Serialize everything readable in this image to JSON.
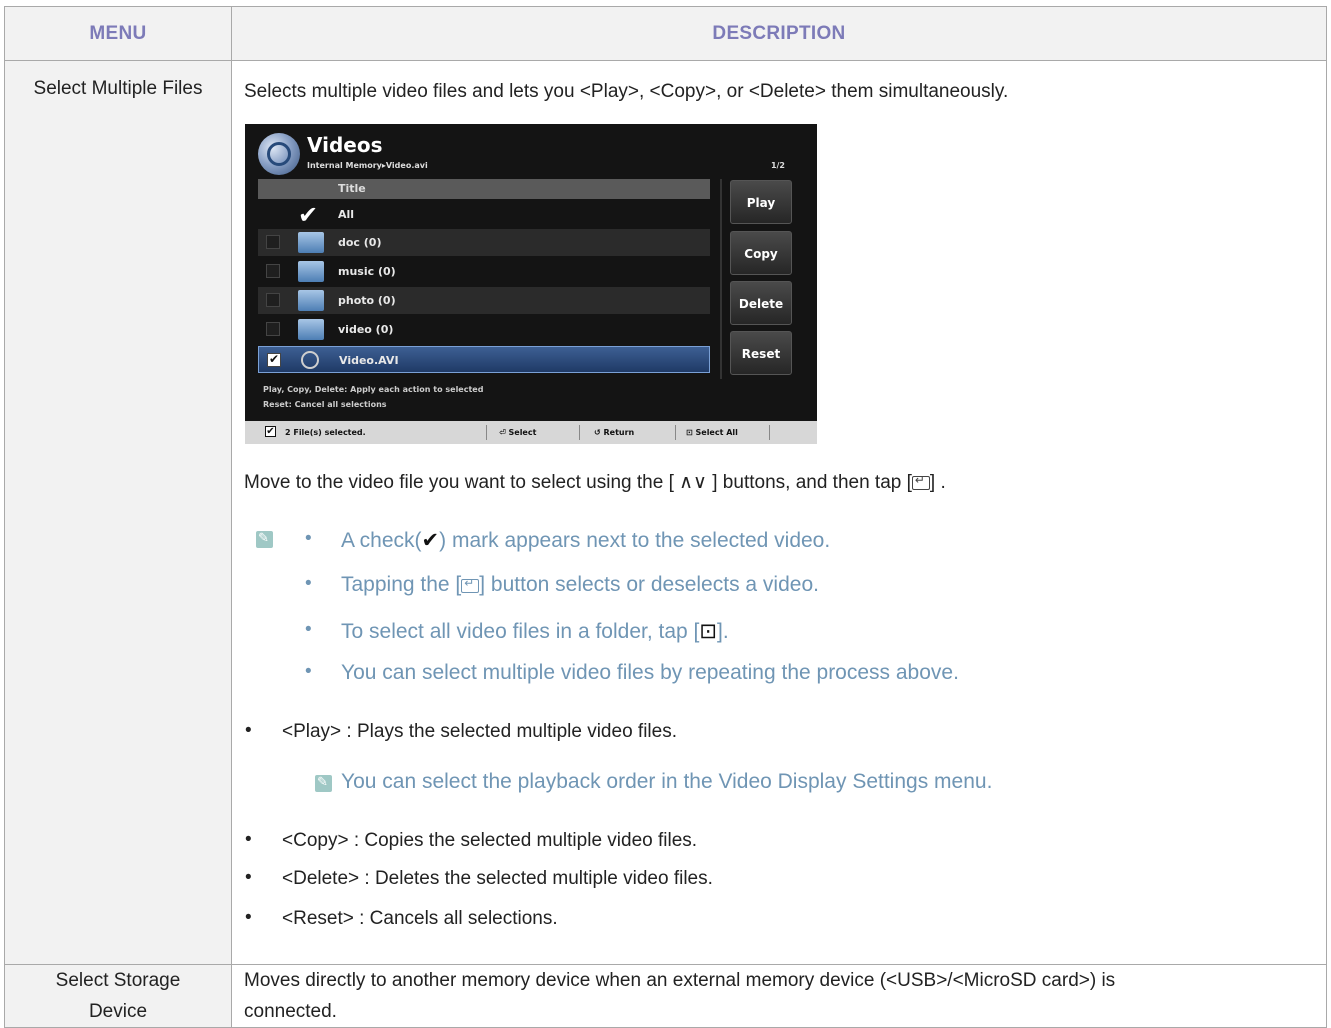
{
  "table": {
    "header_menu": "MENU",
    "header_description": "DESCRIPTION",
    "row1_menu": "Select Multiple Files",
    "row1_intro": "Selects multiple video files and lets you <Play>, <Copy>, or <Delete> them simultaneously.",
    "row1_move_text_a": "Move to the video file you want to select using the [ ",
    "row1_move_arrows": "∧∨",
    "row1_move_text_b": " ] buttons, and then tap [",
    "row1_move_text_c": "] .",
    "notes": {
      "check_a": "A check(",
      "check_mark": "✔",
      "check_b": ") mark appears next to the selected video.",
      "tap_a": "Tapping the [",
      "tap_b": "] button selects or deselects a video.",
      "all_a": "To select all video files in a folder, tap [",
      "all_icon": "⊡",
      "all_b": "].",
      "repeat": "You can select multiple video files by repeating the process above."
    },
    "bullets": {
      "play": "<Play> : Plays the selected multiple video files.",
      "play_note": "You can select the playback order in the Video Display Settings menu.",
      "copy": "<Copy> : Copies the selected multiple video files.",
      "delete": "<Delete> : Deletes the selected multiple video files.",
      "reset": "<Reset> : Cancels all selections."
    },
    "bullet_char": "•",
    "row2_menu_line1": "Select Storage",
    "row2_menu_line2": "Device",
    "row2_desc_line1": "Moves directly to another memory device when an external memory device (<USB>/<MicroSD card>) is",
    "row2_desc_line2": "connected."
  },
  "screenshot": {
    "title": "Videos",
    "path": "Internal Memory▸Video.avi",
    "page": "1/2",
    "column_title": "Title",
    "rows": [
      "All",
      "doc (0)",
      "music (0)",
      "photo (0)",
      "video (0)",
      "Video.AVI"
    ],
    "buttons": [
      "Play",
      "Copy",
      "Delete",
      "Reset"
    ],
    "help_line1": "Play, Copy, Delete: Apply each action to selected",
    "help_line2": "Reset: Cancel all selections",
    "status": "2 File(s) selected.",
    "bar_select": "Select",
    "bar_return": "Return",
    "bar_select_all": "Select All"
  }
}
